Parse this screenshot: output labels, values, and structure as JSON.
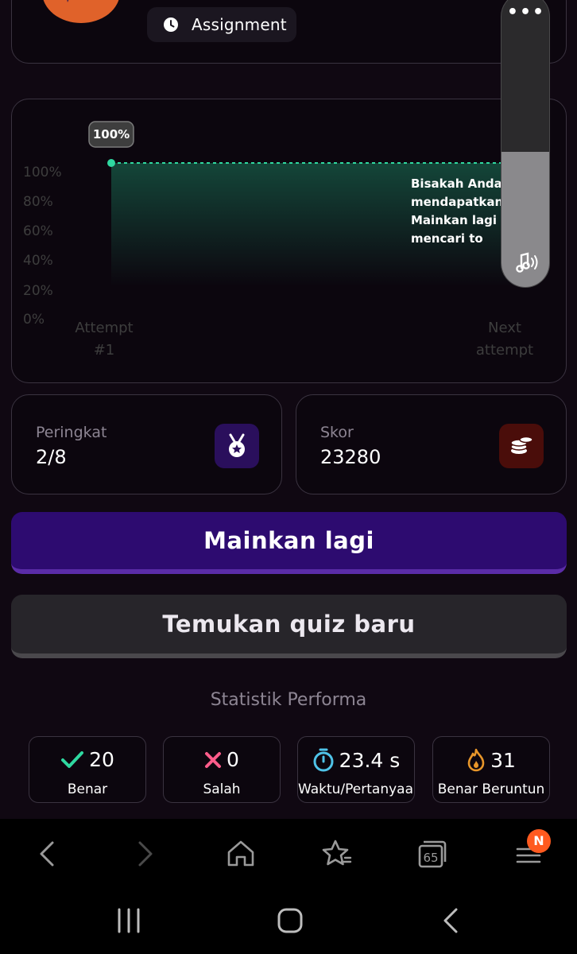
{
  "header": {
    "assignment_label": "Assignment"
  },
  "chart_data": {
    "type": "area",
    "y_tick_labels": [
      "100%",
      "80%",
      "60%",
      "40%",
      "20%",
      "0%"
    ],
    "ylim": [
      0,
      100
    ],
    "categories": [
      "Attempt #1",
      "Next attempt"
    ],
    "x_tick_labels": [
      [
        "Attempt",
        "#1"
      ],
      [
        "Next",
        "attempt"
      ]
    ],
    "series": [
      {
        "values": [
          100,
          100
        ]
      }
    ],
    "data_label": "100%",
    "annotation_lines": [
      "Bisakah Anda",
      "mendapatkan",
      "Mainkan lagi",
      "mencari to"
    ],
    "colors": {
      "line": "#2fd8a0",
      "fill": "#1a7a5c"
    }
  },
  "volume": {
    "level": 0.46,
    "menu_glyph": "•••"
  },
  "stats": {
    "rank": {
      "label": "Peringkat",
      "value": "2/8",
      "icon": "medal-icon"
    },
    "score": {
      "label": "Skor",
      "value": "23280",
      "icon": "coins-icon"
    }
  },
  "actions": {
    "play_again": "Mainkan lagi",
    "find_quiz": "Temukan quiz baru"
  },
  "performance": {
    "title": "Statistik Performa",
    "items": [
      {
        "value": "20",
        "label": "Benar",
        "icon": "check-icon"
      },
      {
        "value": "0",
        "label": "Salah",
        "icon": "cross-icon"
      },
      {
        "value": "23.4 s",
        "label": "Waktu/Pertanyaan",
        "icon": "stopwatch-icon"
      },
      {
        "value": "31",
        "label": "Benar Beruntun",
        "icon": "fire-icon"
      }
    ]
  },
  "browser": {
    "tabs_count": "65",
    "notification_badge": "N"
  },
  "colors": {
    "primary_button": "#2d0b70",
    "secondary_button": "#27252a",
    "check": "#2fd8a0",
    "cross": "#ff5c8a",
    "stopwatch": "#4fc3e8",
    "fire": "#e8962a",
    "medal_box": "#2a0f5c",
    "coins_box": "#4a0d0a"
  }
}
